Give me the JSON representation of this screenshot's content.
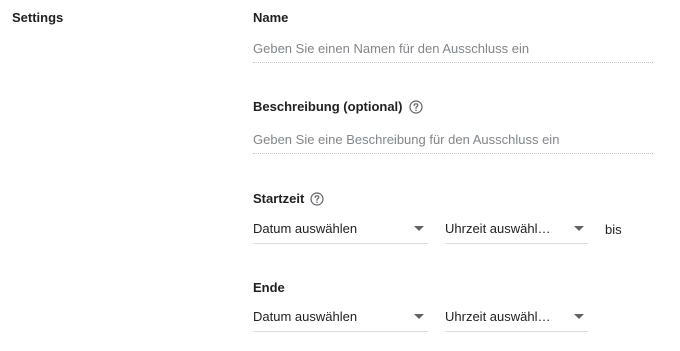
{
  "sidebar": {
    "section_label": "Settings"
  },
  "form": {
    "name": {
      "label": "Name",
      "placeholder": "Geben Sie einen Namen für den Ausschluss ein"
    },
    "description": {
      "label": "Beschreibung (optional)",
      "placeholder": "Geben Sie eine Beschreibung für den Ausschluss ein"
    },
    "start": {
      "label": "Startzeit",
      "date_value": "Datum auswählen",
      "time_value": "Uhrzeit auswähl…",
      "range_word": "bis"
    },
    "end": {
      "label": "Ende",
      "date_value": "Datum auswählen",
      "time_value": "Uhrzeit auswähl…"
    }
  },
  "icons": {
    "help": "help-circle-icon",
    "dropdown": "caret-down-icon"
  },
  "colors": {
    "text": "#202124",
    "placeholder": "#80868b",
    "icon": "#5f6368",
    "divider": "#dadce0"
  }
}
